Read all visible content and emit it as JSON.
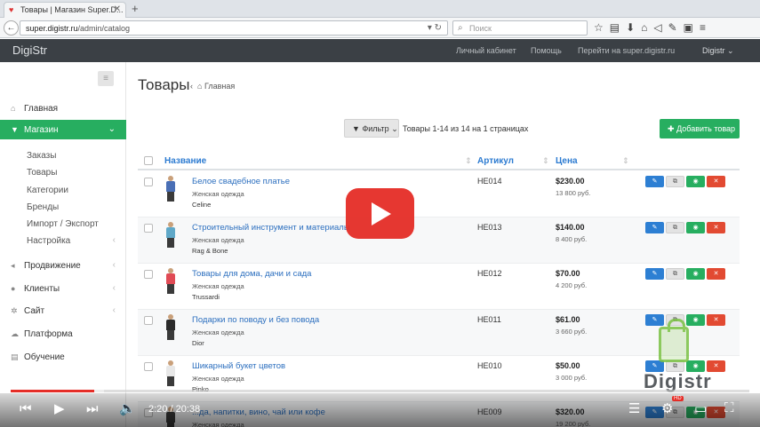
{
  "browser": {
    "tab_title": "Товары | Магазин Super.D...",
    "url_domain": "super.digistr.ru",
    "url_path": "/admin/catalog",
    "search_placeholder": "Поиск"
  },
  "header": {
    "brand": "DigiStr",
    "nav": [
      "Личный кабинет",
      "Помощь",
      "Перейти на super.digistr.ru"
    ],
    "user": "Digistr"
  },
  "sidebar": {
    "items": [
      {
        "label": "Главная",
        "icon": "home-icon"
      },
      {
        "label": "Магазин",
        "icon": "cart-icon",
        "active": true
      },
      {
        "label": "Продвижение",
        "icon": "megaphone-icon"
      },
      {
        "label": "Клиенты",
        "icon": "user-icon"
      },
      {
        "label": "Сайт",
        "icon": "gears-icon"
      },
      {
        "label": "Платформа",
        "icon": "cloud-icon"
      },
      {
        "label": "Обучение",
        "icon": "book-icon"
      }
    ],
    "subitems": [
      "Заказы",
      "Товары",
      "Категории",
      "Бренды",
      "Импорт / Экспорт",
      "Настройка"
    ]
  },
  "main": {
    "title": "Товары",
    "breadcrumb": "Главная",
    "filter_label": "Фильтр",
    "range": "Товары 1-14 из 14 на 1 страницах",
    "add_label": "Добавить товар",
    "columns": {
      "name": "Название",
      "sku": "Артикул",
      "price": "Цена"
    }
  },
  "products": [
    {
      "name": "Белое свадебное платье",
      "category": "Женская одежда",
      "brand": "Celine",
      "sku": "HE014",
      "price": "$230.00",
      "price_rub": "13 800 руб.",
      "shirt_color": "#4a6fb5"
    },
    {
      "name": "Строительный инструмент и материалы",
      "category": "Женская одежда",
      "brand": "Rag & Bone",
      "sku": "HE013",
      "price": "$140.00",
      "price_rub": "8 400 руб.",
      "shirt_color": "#5fa8c8"
    },
    {
      "name": "Товары для дома, дачи и сада",
      "category": "Женская одежда",
      "brand": "Trussardi",
      "sku": "HE012",
      "price": "$70.00",
      "price_rub": "4 200 руб.",
      "shirt_color": "#e04b55"
    },
    {
      "name": "Подарки по поводу и без повода",
      "category": "Женская одежда",
      "brand": "Dior",
      "sku": "HE011",
      "price": "$61.00",
      "price_rub": "3 660 руб.",
      "shirt_color": "#2b2b2b"
    },
    {
      "name": "Шикарный букет цветов",
      "category": "Женская одежда",
      "brand": "Pinko",
      "sku": "HE010",
      "price": "$50.00",
      "price_rub": "3 000 руб.",
      "shirt_color": "#e8e8e8"
    },
    {
      "name": "...да, напитки, вино, чай или кофе",
      "category": "Женская одежда",
      "brand": "",
      "sku": "HE009",
      "price": "$320.00",
      "price_rub": "19 200 руб.",
      "shirt_color": "#3a3a3a"
    }
  ],
  "video": {
    "time": "2:20 / 20:38",
    "progress": 0.113,
    "watermark": "Digistr",
    "hd": "HD"
  }
}
